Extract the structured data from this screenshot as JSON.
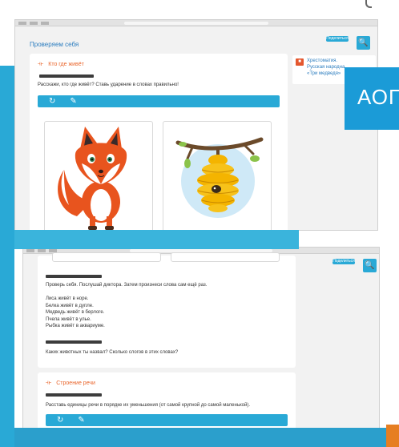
{
  "screen1": {
    "page_title": "Проверяем себя",
    "share_label": "Поделиться",
    "section": {
      "title": "Кто где живёт",
      "instruction": "Расскажи, кто где живёт? Ставь ударение в словах правильно!"
    },
    "tools": [
      {
        "icon": "refresh-icon"
      },
      {
        "icon": "edit-icon"
      }
    ],
    "images": [
      {
        "name": "fox",
        "label": ""
      },
      {
        "name": "beehive",
        "label": ""
      }
    ],
    "side_panel": {
      "lines": [
        "Хрестоматия.",
        "Русская народна",
        "«Три медведя»"
      ]
    }
  },
  "overlay": {
    "aol_text": "АОП"
  },
  "screen2": {
    "share_label": "Поделиться",
    "instruction": "Проверь себя. Послушай диктора. Затем произнеси слова сам ещё раз.",
    "sentences": [
      "Лиса живёт в норе.",
      "Белка живёт в дупле.",
      "Медведь живёт в берлоге.",
      "Пчела живёт в улье.",
      "Рыбка живёт в аквариуме."
    ],
    "question": "Каких животных ты назвал? Сколько слогов в этих словах?",
    "section2": {
      "title": "Строение речи",
      "instruction": "Расставь единицы речи в порядке их уменьшения (от самой крупной до самой маленькой)."
    }
  },
  "colors": {
    "accent": "#29a9d6",
    "orange": "#e9652b"
  }
}
